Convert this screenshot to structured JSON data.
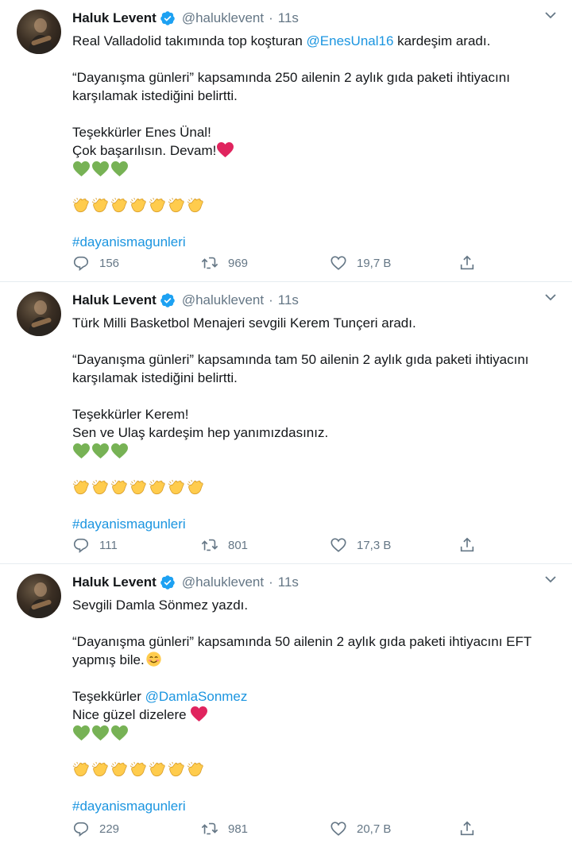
{
  "colors": {
    "link": "#1b95e0",
    "muted": "#657786",
    "verified": "#1da1f2",
    "heart_red": "#e0245e",
    "green_heart": "#77b255",
    "clap": "#ffcc4d"
  },
  "tweets": [
    {
      "name": "Haluk Levent",
      "handle": "@haluklevent",
      "dot": "·",
      "time": "11s",
      "line1_pre": "Real Valladolid takımında top koşturan ",
      "line1_mention": "@EnesUnal16",
      "line1_post": " kardeşim aradı.",
      "para2": "“Dayanışma günleri” kapsamında 250 ailenin 2 aylık gıda paketi ihtiyacını karşılamak istediğini belirtti.",
      "line3": "Teşekkürler Enes Ünal!",
      "line4": "Çok başarılısın. Devam!",
      "hashtag": "#dayanismagunleri",
      "replies": "156",
      "retweets": "969",
      "likes": "19,7 B"
    },
    {
      "name": "Haluk Levent",
      "handle": "@haluklevent",
      "dot": "·",
      "time": "11s",
      "line1": "Türk Milli Basketbol Menajeri sevgili Kerem Tunçeri aradı.",
      "para2": "“Dayanışma günleri” kapsamında tam 50 ailenin 2 aylık gıda paketi ihtiyacını karşılamak istediğini belirtti.",
      "line3": "Teşekkürler Kerem!",
      "line4": "Sen ve Ulaş kardeşim hep yanımızdasınız.",
      "hashtag": "#dayanismagunleri",
      "replies": "111",
      "retweets": "801",
      "likes": "17,3 B"
    },
    {
      "name": "Haluk Levent",
      "handle": "@haluklevent",
      "dot": "·",
      "time": "11s",
      "line1": "Sevgili Damla Sönmez yazdı.",
      "para2": "“Dayanışma günleri” kapsamında 50 ailenin 2 aylık gıda paketi ihtiyacını EFT yapmış bile.",
      "line3_pre": "Teşekkürler ",
      "line3_mention": "@DamlaSonmez",
      "line4": "Nice güzel dizelere",
      "hashtag": "#dayanismagunleri",
      "replies": "229",
      "retweets": "981",
      "likes": "20,7 B"
    }
  ]
}
